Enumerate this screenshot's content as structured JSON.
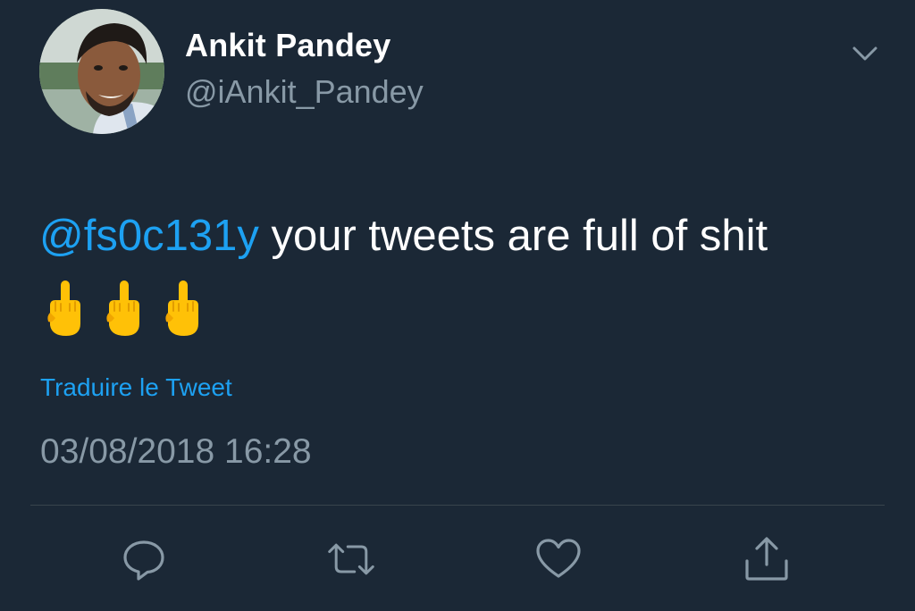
{
  "tweet": {
    "author": {
      "display_name": "Ankit Pandey",
      "handle": "@iAnkit_Pandey"
    },
    "text": {
      "mention": "@fs0c131y",
      "body": " your tweets are full of shit"
    },
    "emojis": [
      "middle-finger",
      "middle-finger",
      "middle-finger"
    ],
    "translate_label": "Traduire le Tweet",
    "timestamp": "03/08/2018 16:28",
    "actions": [
      "reply",
      "retweet",
      "like",
      "share"
    ]
  },
  "colors": {
    "background": "#1b2836",
    "accent": "#1da1f2",
    "secondary_text": "#8899a6",
    "primary_text": "#ffffff"
  }
}
